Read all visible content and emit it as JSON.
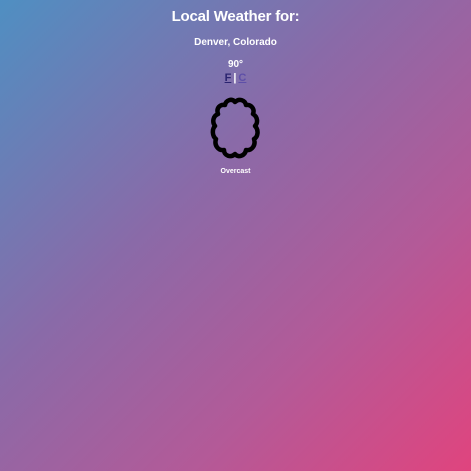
{
  "weather": {
    "heading": "Local Weather for:",
    "location": "Denver, Colorado",
    "temperature": "90°",
    "unit_f": "F",
    "unit_separator": "|",
    "unit_c": "C",
    "condition": "Overcast",
    "icon": "cloud-icon"
  },
  "colors": {
    "gradient_start": "#4f8fc2",
    "gradient_end": "#e0447e",
    "text": "#ffffff",
    "unit_link": "#2a2470"
  }
}
